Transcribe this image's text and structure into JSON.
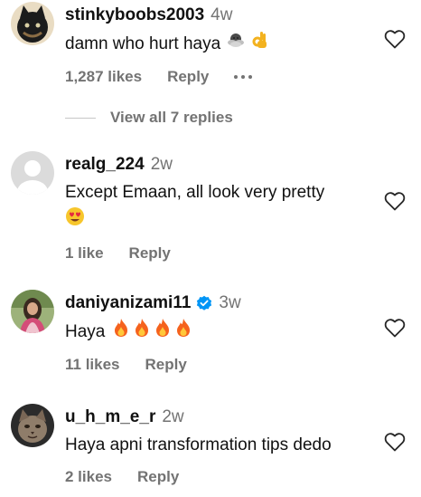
{
  "comments": [
    {
      "username": "stinkyboobs2003",
      "time": "4w",
      "text": "damn who hurt haya",
      "emojis": [
        "face-in-clouds-emoji",
        "ok-hand-emoji"
      ],
      "likes": "1,287 likes",
      "reply": "Reply",
      "avatar": "dark-cat-avatar"
    },
    {
      "username": "realg_224",
      "time": "2w",
      "text": "Except Emaan, all look very pretty",
      "emojis": [
        "heart-eyes-emoji"
      ],
      "likes": "1 like",
      "reply": "Reply",
      "avatar": "default-avatar"
    },
    {
      "username": "daniyanizami11",
      "time": "3w",
      "verified": true,
      "text": "Haya",
      "emojis": [
        "fire-emoji",
        "fire-emoji",
        "fire-emoji",
        "fire-emoji"
      ],
      "likes": "11 likes",
      "reply": "Reply",
      "avatar": "woman-photo-avatar"
    },
    {
      "username": "u_h_m_e_r",
      "time": "2w",
      "text": "Haya apni transformation tips dedo",
      "likes": "2 likes",
      "reply": "Reply",
      "avatar": "cat-photo-avatar"
    }
  ],
  "view_replies": "View all 7 replies",
  "colors": {
    "text": "#111111",
    "muted": "#737373",
    "verified": "#0095f6",
    "fire": "#f5621d"
  }
}
